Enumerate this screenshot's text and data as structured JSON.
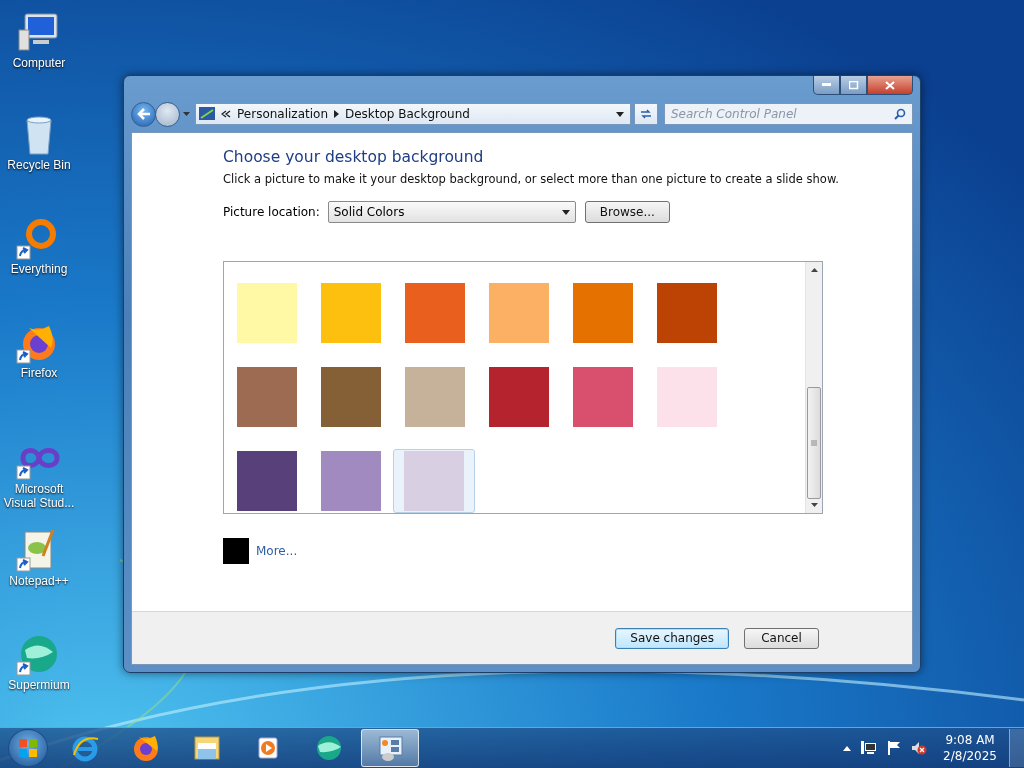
{
  "desktop_icons": [
    {
      "label": "Computer",
      "kind": "computer",
      "shortcut": false
    },
    {
      "label": "Recycle Bin",
      "kind": "bin",
      "shortcut": false
    },
    {
      "label": "Everything",
      "kind": "ring",
      "shortcut": true
    },
    {
      "label": "Firefox",
      "kind": "fox",
      "shortcut": true
    },
    {
      "label": "Microsoft Visual Stud...",
      "kind": "infinity",
      "shortcut": true
    },
    {
      "label": "Notepad++",
      "kind": "notepad",
      "shortcut": true
    },
    {
      "label": "Supermium",
      "kind": "globe",
      "shortcut": true
    }
  ],
  "window": {
    "breadcrumb": [
      "Personalization",
      "Desktop Background"
    ],
    "search": {
      "placeholder": "Search Control Panel"
    },
    "heading": "Choose your desktop background",
    "description": "Click a picture to make it your desktop background, or select more than one picture to create a slide show.",
    "location_label": "Picture location:",
    "location_value": "Solid Colors",
    "browse_button": "Browse...",
    "swatches": [
      {
        "color": "#fff9a5",
        "selected": false
      },
      {
        "color": "#fdc00f",
        "selected": false
      },
      {
        "color": "#e9601e",
        "selected": false
      },
      {
        "color": "#fbb063",
        "selected": false
      },
      {
        "color": "#e57200",
        "selected": false
      },
      {
        "color": "#bc4303",
        "selected": false
      },
      {
        "color": "#9c6b52",
        "selected": false
      },
      {
        "color": "#855f36",
        "selected": false
      },
      {
        "color": "#c6b29b",
        "selected": false
      },
      {
        "color": "#b5232f",
        "selected": false
      },
      {
        "color": "#d8506e",
        "selected": false
      },
      {
        "color": "#fde1ea",
        "selected": false
      },
      {
        "color": "#58407b",
        "selected": false
      },
      {
        "color": "#a08abf",
        "selected": false
      },
      {
        "color": "#d9cfe3",
        "selected": true
      }
    ],
    "more": {
      "color": "#000000",
      "label": "More..."
    },
    "buttons": [
      {
        "label": "Save changes",
        "default": true
      },
      {
        "label": "Cancel",
        "default": false
      }
    ]
  },
  "taskbar": {
    "items": [
      {
        "kind": "ie",
        "active": false
      },
      {
        "kind": "fox",
        "active": false
      },
      {
        "kind": "folder",
        "active": false
      },
      {
        "kind": "player",
        "active": false
      },
      {
        "kind": "globe",
        "active": false
      },
      {
        "kind": "panel",
        "active": true
      }
    ],
    "time": "9:08 AM",
    "date": "2/8/2025"
  }
}
